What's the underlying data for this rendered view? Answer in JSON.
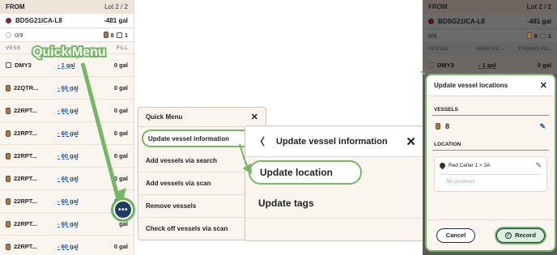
{
  "left_panel": {
    "header": {
      "from_label": "FROM",
      "lot_label": "Lot 2 / 2"
    },
    "source": {
      "name": "BDSG21ICA-L8",
      "amount": "-481 gal"
    },
    "counts": {
      "progress": "0/9",
      "barrels": "8",
      "other": "1"
    },
    "columns": {
      "vessel": "VESS",
      "remove": "",
      "fill": "FILL"
    },
    "rows": [
      {
        "name": "DMY3",
        "remove": "- 1 gal",
        "fill": "0 gal",
        "icon": "bookmark-icon"
      },
      {
        "name": "22QTR...",
        "remove": "- 60 gal",
        "fill": "0 gal",
        "icon": "barrel-icon"
      },
      {
        "name": "22RPT...",
        "remove": "- 60 gal",
        "fill": "0 gal",
        "icon": "barrel-icon"
      },
      {
        "name": "22RPT...",
        "remove": "- 60 gal",
        "fill": "0 gal",
        "icon": "barrel-icon"
      },
      {
        "name": "22RPT...",
        "remove": "- 60 gal",
        "fill": "0 gal",
        "icon": "barrel-icon"
      },
      {
        "name": "22RPT...",
        "remove": "- 60 gal",
        "fill": "0 gal",
        "icon": "barrel-icon"
      },
      {
        "name": "22RPT...",
        "remove": "- 60 gal",
        "fill": "0 gal",
        "icon": "barrel-icon"
      },
      {
        "name": "22RPT...",
        "remove": "- 60 gal",
        "fill": "gal",
        "icon": "barrel-icon"
      },
      {
        "name": "22RPT...",
        "remove": "- 60 gal",
        "fill": "0 gal",
        "icon": "barrel-icon"
      }
    ],
    "overlay_label": "Quick Menu",
    "more_button": "•••"
  },
  "quick_menu": {
    "title": "Quick Menu",
    "items": [
      "Update vessel information",
      "Add vessels via search",
      "Add vessels via scan",
      "Remove vessels",
      "Check off vessels via scan"
    ]
  },
  "vessel_info_menu": {
    "title": "Update vessel information",
    "items": [
      "Update location",
      "Update tags"
    ]
  },
  "right_panel": {
    "header": {
      "from_label": "FROM",
      "lot_label": "Lot 2 / 2"
    },
    "source": {
      "name": "BDSG21ICA-L8",
      "amount": "-481 gal"
    },
    "counts": {
      "progress": "0/9",
      "barrels": "8",
      "other": "1"
    },
    "columns": {
      "vessel": "VESSEL",
      "remove": "REMOVE",
      "fill": "ENDING FILL"
    },
    "row": {
      "name": "DMY3",
      "remove": "- 1 gal",
      "fill": "0 gal"
    }
  },
  "location_modal": {
    "title": "Update vessel locations",
    "vessels_label": "VESSELS",
    "vessels_count": "8",
    "location_label": "LOCATION",
    "location_value": "Red Cellar 1  >  3A",
    "no_positions": "No positions",
    "cancel_label": "Cancel",
    "record_label": "Record"
  },
  "colors": {
    "highlight": "#74b867",
    "accent_link": "#1b4b8a",
    "navy": "#1f3c63"
  }
}
